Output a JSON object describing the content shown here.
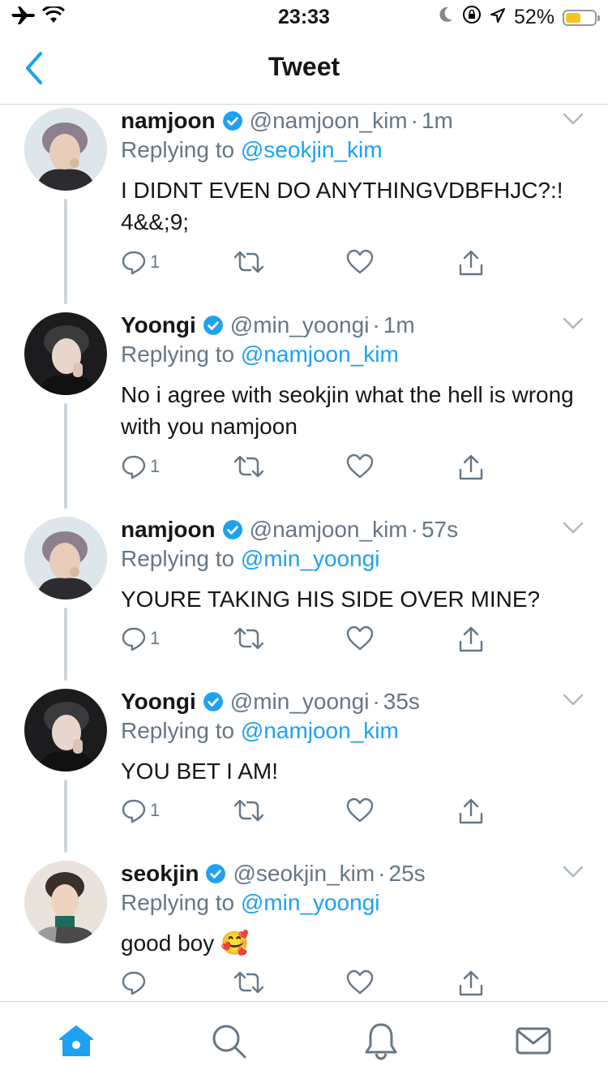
{
  "status_bar": {
    "time": "23:33",
    "battery": "52%",
    "battery_level": 0.52
  },
  "nav": {
    "title": "Tweet"
  },
  "tweets": [
    {
      "name": "namjoon",
      "handle": "@namjoon_kim",
      "time": "1m",
      "replying_prefix": "Replying to",
      "replying_to": "@seokjin_kim",
      "text": "I DIDNT EVEN DO ANYTHINGVDBFHJC?:! 4&&;9;",
      "reply_count": "1",
      "avatar": "avatar-namjoon"
    },
    {
      "name": "Yoongi",
      "handle": "@min_yoongi",
      "time": "1m",
      "replying_prefix": "Replying to",
      "replying_to": "@namjoon_kim",
      "text": "No i agree with seokjin what the hell is wrong with you namjoon",
      "reply_count": "1",
      "avatar": "avatar-yoongi"
    },
    {
      "name": "namjoon",
      "handle": "@namjoon_kim",
      "time": "57s",
      "replying_prefix": "Replying to",
      "replying_to": "@min_yoongi",
      "text": "YOURE TAKING HIS SIDE OVER MINE?",
      "reply_count": "1",
      "avatar": "avatar-namjoon"
    },
    {
      "name": "Yoongi",
      "handle": "@min_yoongi",
      "time": "35s",
      "replying_prefix": "Replying to",
      "replying_to": "@namjoon_kim",
      "text": "YOU BET I AM!",
      "reply_count": "1",
      "avatar": "avatar-yoongi"
    },
    {
      "name": "seokjin",
      "handle": "@seokjin_kim",
      "time": "25s",
      "replying_prefix": "Replying to",
      "replying_to": "@min_yoongi",
      "text": "good boy 🥰",
      "reply_count": "",
      "avatar": "avatar-seokjin"
    }
  ],
  "tabs": [
    "home-icon",
    "search-icon",
    "notifications-icon",
    "messages-icon"
  ],
  "colors": {
    "accent": "#1da1f2",
    "verified": "#1da1f2",
    "secondary_text": "#657786",
    "tab_active": "#1da1f2",
    "tab_inactive": "#657786"
  }
}
